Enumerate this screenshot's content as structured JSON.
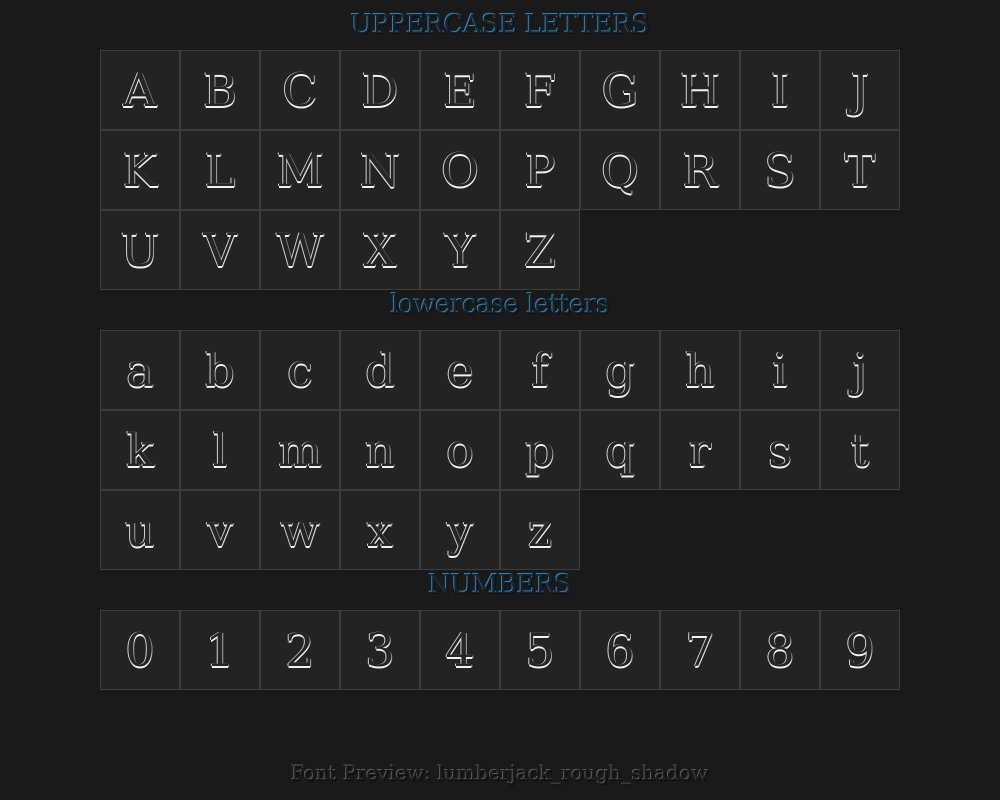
{
  "sections": {
    "uppercase": {
      "title": "UPPERCASE LETTERS",
      "glyphs": [
        "A",
        "B",
        "C",
        "D",
        "E",
        "F",
        "G",
        "H",
        "I",
        "J",
        "K",
        "L",
        "M",
        "N",
        "O",
        "P",
        "Q",
        "R",
        "S",
        "T",
        "U",
        "V",
        "W",
        "X",
        "Y",
        "Z"
      ]
    },
    "lowercase": {
      "title": "lowercase letters",
      "glyphs": [
        "a",
        "b",
        "c",
        "d",
        "e",
        "f",
        "g",
        "h",
        "i",
        "j",
        "k",
        "l",
        "m",
        "n",
        "o",
        "p",
        "q",
        "r",
        "s",
        "t",
        "u",
        "v",
        "w",
        "x",
        "y",
        "z"
      ]
    },
    "numbers": {
      "title": "NUMBERS",
      "glyphs": [
        "0",
        "1",
        "2",
        "3",
        "4",
        "5",
        "6",
        "7",
        "8",
        "9"
      ]
    }
  },
  "footer": {
    "text": "Font Preview: lumberjack_rough_shadow"
  },
  "colors": {
    "background": "#1a1a1a",
    "cell_background": "#232323",
    "cell_border": "#3c3c3c",
    "title_accent": "#3b7fa8",
    "glyph_highlight": "#f2f2f2"
  }
}
